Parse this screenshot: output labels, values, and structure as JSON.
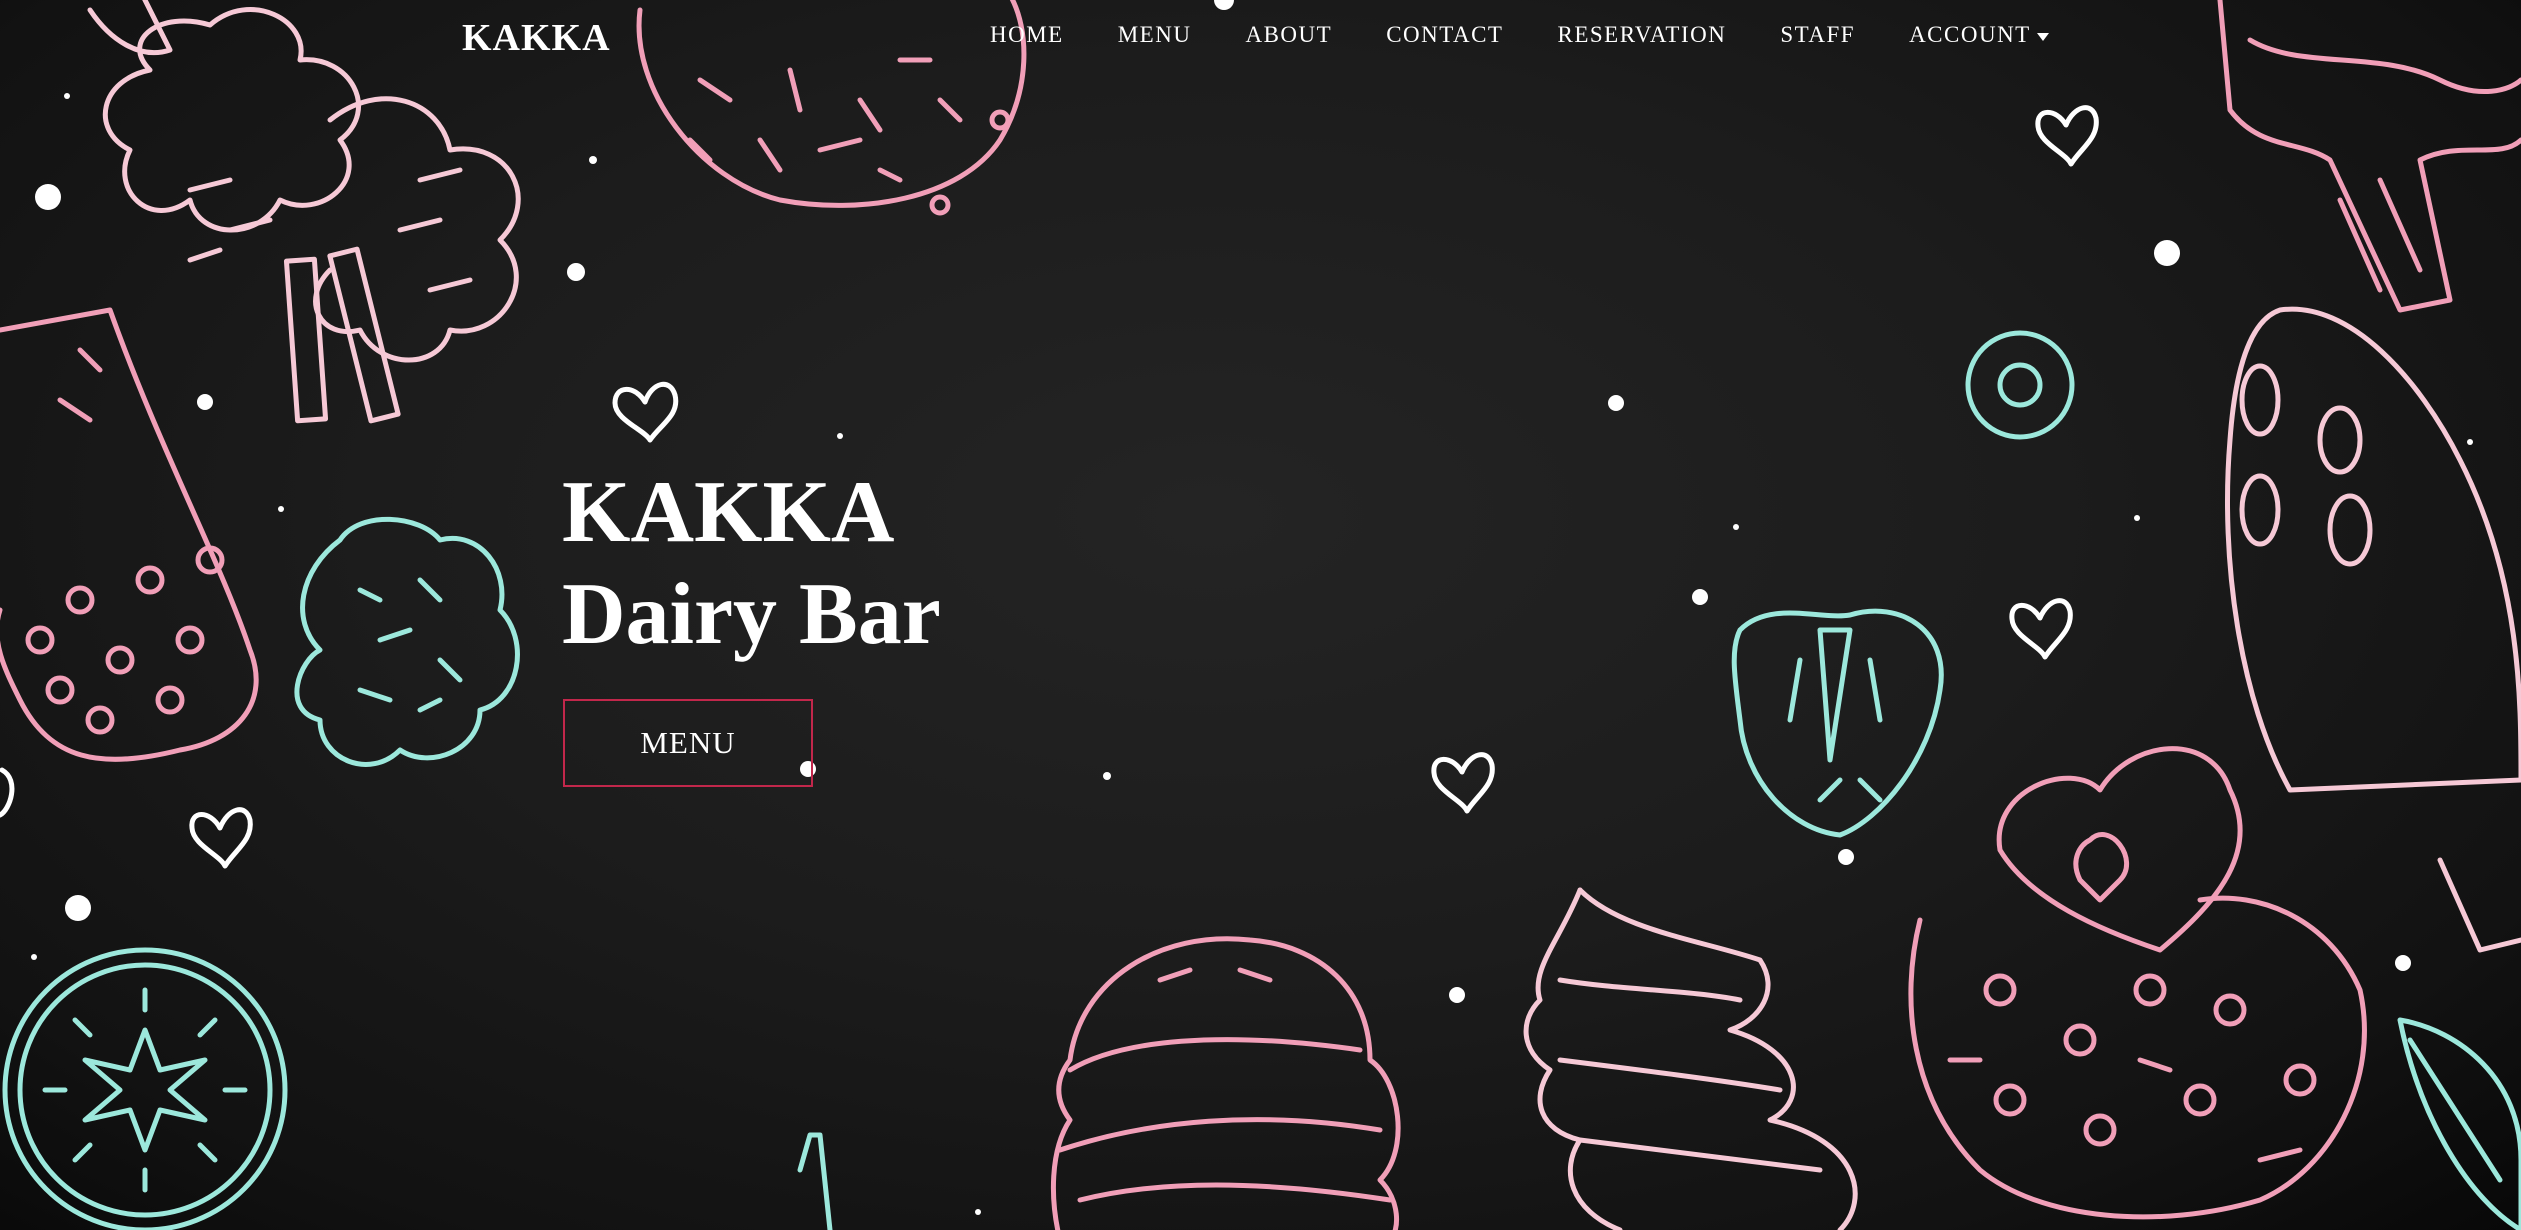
{
  "navbar": {
    "brand": "KAKKA",
    "links": [
      {
        "label": "HOME"
      },
      {
        "label": "MENU"
      },
      {
        "label": "ABOUT"
      },
      {
        "label": "CONTACT"
      },
      {
        "label": "RESERVATION"
      },
      {
        "label": "STAFF"
      },
      {
        "label": "ACCOUNT",
        "icon": "caret-down-icon"
      }
    ]
  },
  "hero": {
    "title_line1": "KAKKA",
    "title_line2": "Dairy Bar",
    "button_label": "MENU"
  },
  "theme": {
    "background": "#1c1c1c",
    "doodle_pink": "#f19fb8",
    "doodle_light_pink": "#f6c9d6",
    "doodle_mint": "#9ce8dc",
    "button_border": "#c2274b",
    "text": "#ffffff"
  },
  "decorations": [
    "cotton-candy-icon",
    "donut-icon",
    "popsicle-icon",
    "raspberry-icon",
    "kiwi-icon",
    "cupcake-icon",
    "strawberry-icon",
    "heart-icon",
    "cream-swirl-icon",
    "macaron-icon",
    "leaf-icon",
    "ring-candy-icon"
  ]
}
